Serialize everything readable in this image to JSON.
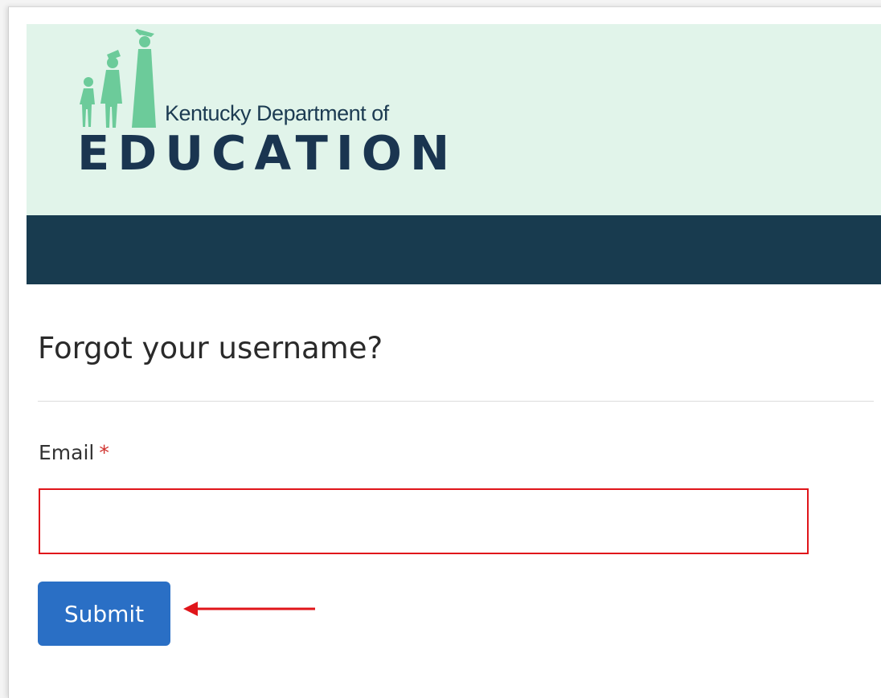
{
  "header": {
    "logo": {
      "organization_line": "Kentucky Department of",
      "wordmark": "EDUCATION"
    },
    "colors": {
      "banner_bg": "#e1f4ea",
      "nav_bar_bg": "#183b4f",
      "figures": "#6ccb9a"
    }
  },
  "main": {
    "title": "Forgot your username?",
    "email_field": {
      "label": "Email",
      "required_marker": "*",
      "value": "",
      "placeholder": ""
    },
    "submit_label": "Submit"
  },
  "annotation": {
    "arrow_icon": "arrow-left-icon",
    "color": "#e0151a"
  },
  "theme": {
    "primary_button": "#2a6fc5",
    "error_border": "#e0151a",
    "required_color": "#d0312d"
  }
}
